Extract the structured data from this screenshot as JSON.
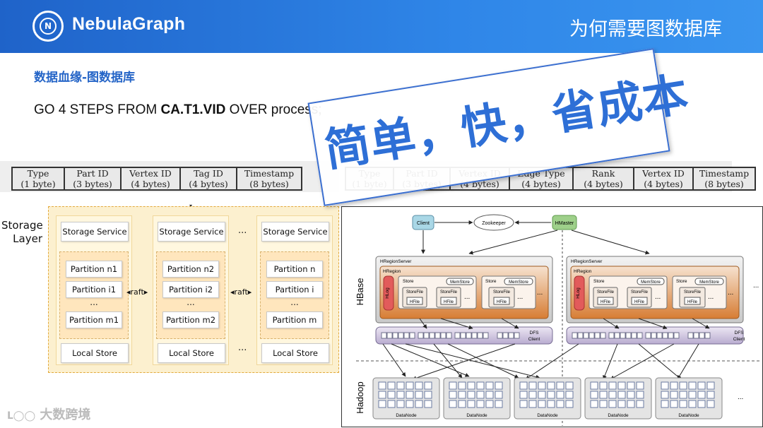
{
  "header": {
    "brand": "NebulaGraph",
    "logo_letter": "N",
    "slide_title": "为何需要图数据库",
    "bg_color": "#2a7ae0"
  },
  "subheading": "数据血缘-图数据库",
  "query": {
    "prefix": "GO 4 STEPS FROM ",
    "bold": "CA.T1.VID",
    "suffix": " OVER process;"
  },
  "stamp": {
    "text": "简单，快，省成本",
    "color": "#2e6fd6"
  },
  "vertex_key": [
    [
      "Type",
      "(1 byte)"
    ],
    [
      "Part ID",
      "(3 bytes)"
    ],
    [
      "Vertex ID",
      "(4 bytes)"
    ],
    [
      "Tag ID",
      "(4 bytes)"
    ],
    [
      "Timestamp",
      "(8 bytes)"
    ]
  ],
  "edge_key": [
    [
      "Type",
      "(1 byte)"
    ],
    [
      "Part ID",
      "(3 bytes)"
    ],
    [
      "Vertex ID",
      "(4 bytes)"
    ],
    [
      "Edge Type",
      "(4 bytes)"
    ],
    [
      "Rank",
      "(4 bytes)"
    ],
    [
      "Vertex ID",
      "(4 bytes)"
    ],
    [
      "Timestamp",
      "(8 bytes)"
    ]
  ],
  "storage": {
    "label_line1": "Storage",
    "label_line2": "Layer",
    "columns": [
      {
        "service": "Storage Service",
        "partitions": [
          "Partition n1",
          "Partition i1",
          "Partition m1"
        ],
        "local": "Local Store"
      },
      {
        "service": "Storage Service",
        "partitions": [
          "Partition n2",
          "Partition i2",
          "Partition m2"
        ],
        "local": "Local Store"
      },
      {
        "service": "Storage Service",
        "partitions": [
          "Partition n",
          "Partition i",
          "Partition m"
        ],
        "local": "Local Store"
      }
    ],
    "raft_label": "raft",
    "ellipsis": "..."
  },
  "hbase": {
    "client": "Client",
    "zookeeper": "Zookeeper",
    "hmaster": "HMaster",
    "region_server": "HRegionServer",
    "region": "HRegion",
    "hlog": "HLog",
    "store": "Store",
    "memstore": "MemStore",
    "storefile": "StoreFile",
    "hfile": "HFile",
    "dfs_client_line1": "DFS",
    "dfs_client_line2": "Client",
    "hbase_label": "HBase",
    "hadoop_label": "Hadoop",
    "datanode": "DataNode",
    "ellipsis": "..."
  },
  "watermark": "大数跨境"
}
